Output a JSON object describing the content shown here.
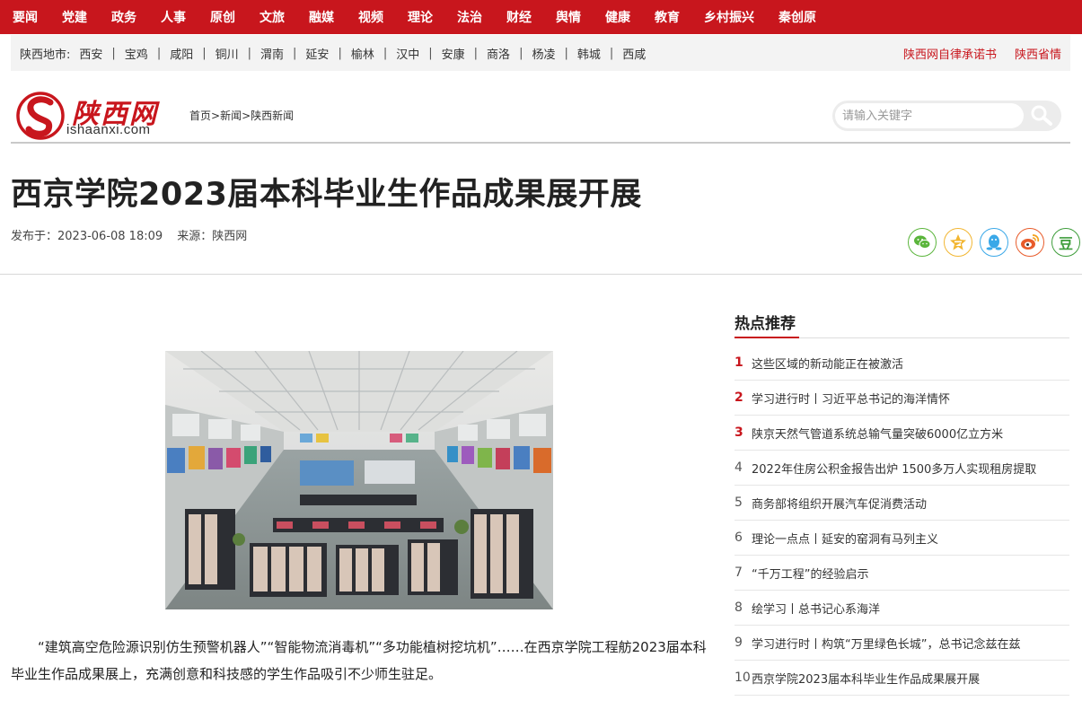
{
  "topnav": [
    "要闻",
    "党建",
    "政务",
    "人事",
    "原创",
    "文旅",
    "融媒",
    "视频",
    "理论",
    "法治",
    "财经",
    "舆情",
    "健康",
    "教育",
    "乡村振兴",
    "秦创原"
  ],
  "region": {
    "title": "陕西地市:",
    "items": [
      "西安",
      "宝鸡",
      "咸阳",
      "铜川",
      "渭南",
      "延安",
      "榆林",
      "汉中",
      "安康",
      "商洛",
      "杨凌",
      "韩城",
      "西咸"
    ],
    "links": [
      "陕西网自律承诺书",
      "陕西省情"
    ]
  },
  "logo": {
    "text": "陕西网",
    "sub": "ishaanxi.com"
  },
  "breadcrumb": {
    "home": "首页",
    "news": "新闻",
    "section": "陕西新闻",
    "sep": ">"
  },
  "search": {
    "placeholder": "请输入关键字"
  },
  "article": {
    "title": "西京学院2023届本科毕业生作品成果展开展",
    "published": "发布于：2023-06-08 18:09",
    "source": "来源：陕西网",
    "paragraph": "“建筑高空危险源识别仿生预警机器人”“智能物流消毒机”“多功能植树挖坑机”……在西京学院工程舫2023届本科毕业生作品成果展上，充满创意和科技感的学生作品吸引不少师生驻足。"
  },
  "share": [
    {
      "icon": "wechat-icon",
      "color": "#5bb53c"
    },
    {
      "icon": "qzone-icon",
      "color": "#f2b632"
    },
    {
      "icon": "qq-icon",
      "color": "#3aa8e8"
    },
    {
      "icon": "weibo-icon",
      "color": "#e85c2b"
    },
    {
      "icon": "douban-icon",
      "color": "#3e9d3b",
      "glyph": "豆"
    }
  ],
  "hot": {
    "title": "热点推荐",
    "items": [
      {
        "rank": "1",
        "text": "这些区域的新动能正在被激活"
      },
      {
        "rank": "2",
        "text": "学习进行时丨习近平总书记的海洋情怀"
      },
      {
        "rank": "3",
        "text": "陕京天然气管道系统总输气量突破6000亿立方米"
      },
      {
        "rank": "4",
        "text": "2022年住房公积金报告出炉 1500多万人实现租房提取"
      },
      {
        "rank": "5",
        "text": "商务部将组织开展汽车促消费活动"
      },
      {
        "rank": "6",
        "text": "理论一点点丨延安的窑洞有马列主义"
      },
      {
        "rank": "7",
        "text": "“千万工程”的经验启示"
      },
      {
        "rank": "8",
        "text": "绘学习丨总书记心系海洋"
      },
      {
        "rank": "9",
        "text": "学习进行时丨构筑“万里绿色长城”，总书记念兹在兹"
      },
      {
        "rank": "10",
        "text": "西京学院2023届本科毕业生作品成果展开展"
      }
    ]
  },
  "colors": {
    "brand_red": "#c8161d",
    "region_bg": "#f3f3f3"
  }
}
